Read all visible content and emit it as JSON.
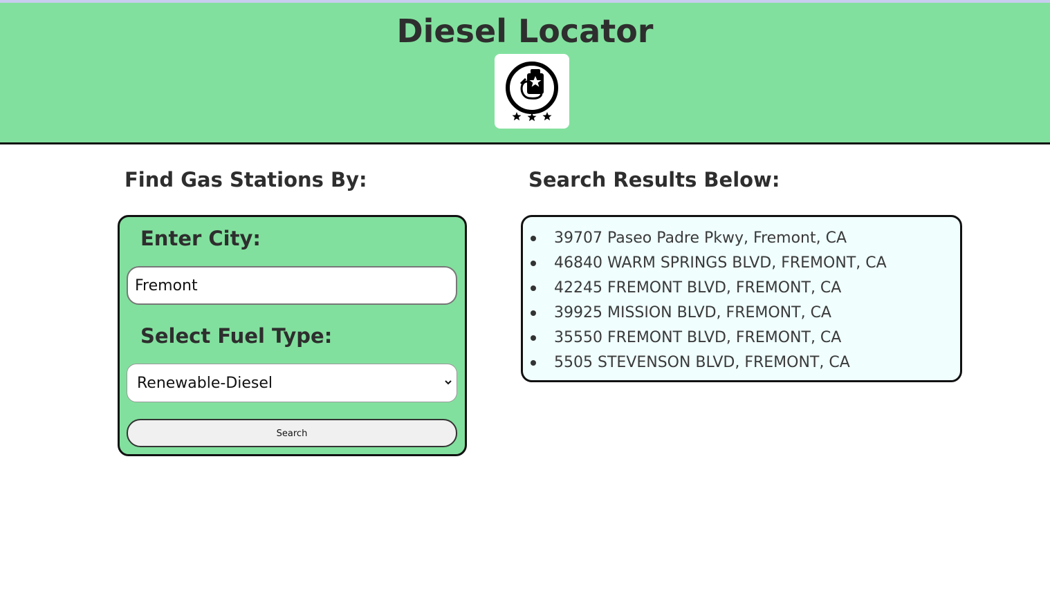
{
  "header": {
    "title": "Diesel Locator",
    "logo_icon": "fuel-pump-badge-icon",
    "background_color": "#82e09e"
  },
  "search_form": {
    "heading": "Find Gas Stations By:",
    "city_label": "Enter City:",
    "city_value": "Fremont",
    "fuel_label": "Select Fuel Type:",
    "fuel_selected": "Renewable-Diesel",
    "search_button_label": "Search"
  },
  "results": {
    "heading": "Search Results Below:",
    "items": [
      "39707 Paseo Padre Pkwy, Fremont, CA",
      "46840 WARM SPRINGS BLVD, FREMONT, CA",
      "42245 FREMONT BLVD, FREMONT, CA",
      "39925 MISSION BLVD, FREMONT, CA",
      "35550 FREMONT BLVD, FREMONT, CA",
      "5505 STEVENSON BLVD, FREMONT, CA"
    ],
    "background_color": "#f0fefe"
  }
}
